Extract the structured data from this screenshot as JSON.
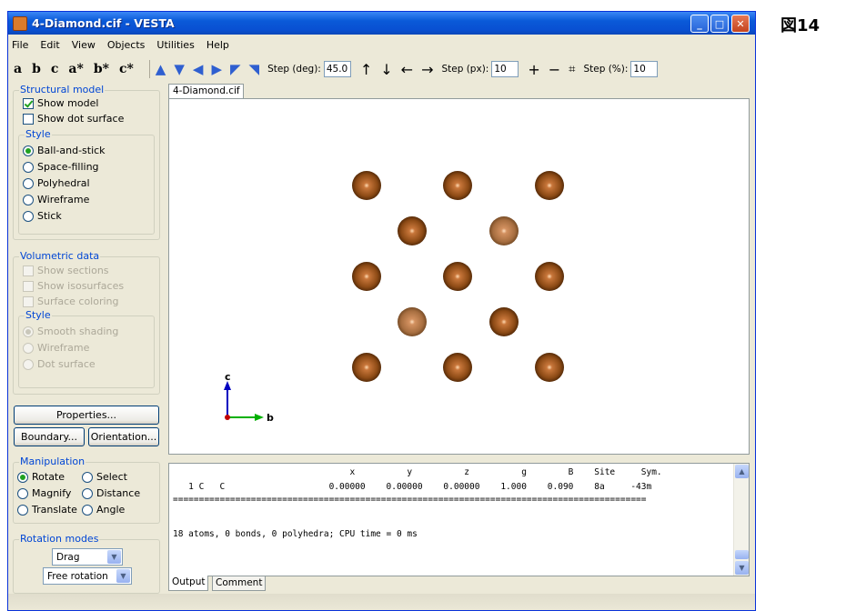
{
  "window": {
    "title": "4-Diamond.cif - VESTA"
  },
  "page_heading": "図14",
  "menu": [
    "File",
    "Edit",
    "View",
    "Objects",
    "Utilities",
    "Help"
  ],
  "toolbar": {
    "axis_buttons": [
      "a",
      "b",
      "c",
      "a*",
      "b*",
      "c*"
    ],
    "step_deg_label": "Step (deg):",
    "step_deg_value": "45.0",
    "step_px_label": "Step (px):",
    "step_px_value": "10",
    "step_pct_label": "Step (%):",
    "step_pct_value": "10"
  },
  "structural_model": {
    "legend": "Structural model",
    "show_model": "Show model",
    "show_dot_surface": "Show dot surface",
    "style_legend": "Style",
    "styles": [
      "Ball-and-stick",
      "Space-filling",
      "Polyhedral",
      "Wireframe",
      "Stick"
    ],
    "selected_style": "Ball-and-stick"
  },
  "volumetric": {
    "legend": "Volumetric data",
    "show_sections": "Show sections",
    "show_isosurfaces": "Show isosurfaces",
    "surface_coloring": "Surface coloring",
    "style_legend": "Style",
    "styles": [
      "Smooth shading",
      "Wireframe",
      "Dot surface"
    ]
  },
  "buttons": {
    "properties": "Properties...",
    "boundary": "Boundary...",
    "orientation": "Orientation..."
  },
  "manipulation": {
    "legend": "Manipulation",
    "options": [
      "Rotate",
      "Select",
      "Magnify",
      "Distance",
      "Translate",
      "Angle"
    ],
    "selected": "Rotate"
  },
  "rotation_modes": {
    "legend": "Rotation modes",
    "drag": "Drag",
    "free": "Free rotation"
  },
  "viewer": {
    "tab": "4-Diamond.cif",
    "axis_c": "c",
    "axis_b": "b"
  },
  "output": {
    "header": "                                  x          y          z          g        B    Site     Sym.",
    "row": "   1 C   C                    0.00000    0.00000    0.00000    1.000    0.090    8a     -43m",
    "separator": "===========================================================================================",
    "summary": "18 atoms, 0 bonds, 0 polyhedra; CPU time = 0 ms",
    "tabs": [
      "Output",
      "Comment"
    ]
  }
}
